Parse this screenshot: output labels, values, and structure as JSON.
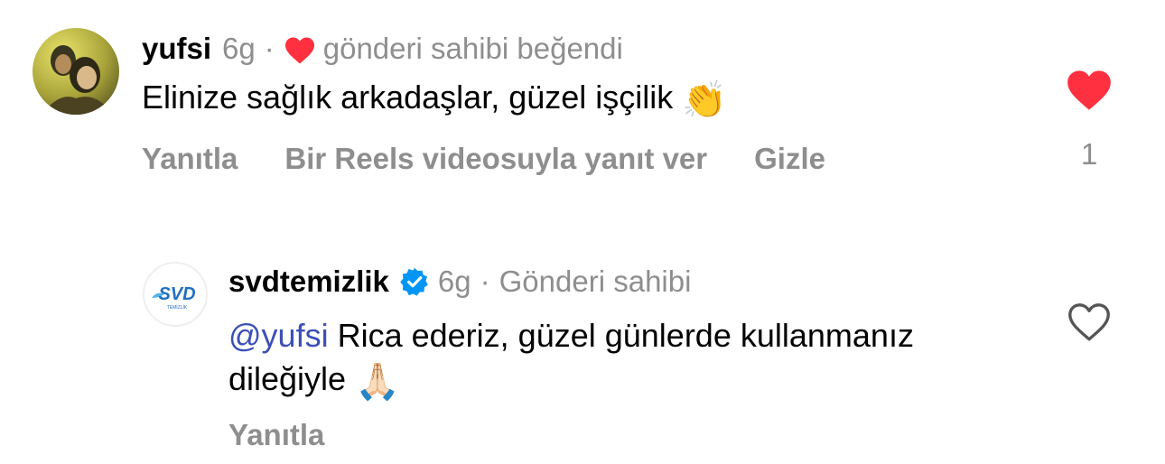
{
  "comments": [
    {
      "username": "yufsi",
      "time": "6g",
      "separator": "·",
      "liked_by_author_label": "gönderi sahibi beğendi",
      "text": "Elinize sağlık arkadaşlar, güzel işçilik",
      "text_emoji": "👏",
      "actions": {
        "reply": "Yanıtla",
        "reels_reply": "Bir Reels videosuyla yanıt ver",
        "hide": "Gizle"
      },
      "like_count": "1",
      "liked": true
    },
    {
      "username": "svdtemizlik",
      "verified": true,
      "time": "6g",
      "separator": "·",
      "author_label": "Gönderi sahibi",
      "mention": "@yufsi",
      "text": "Rica ederiz, güzel günlerde kullanmanız dileğiyle",
      "text_emoji": "🙏🏻",
      "avatar_text": "SVD",
      "avatar_subtext": "TEMİZLİK",
      "actions": {
        "reply": "Yanıtla"
      },
      "liked": false
    }
  ],
  "colors": {
    "like_red": "#ff3040",
    "meta_gray": "#8e8e8e",
    "mention_blue": "#3c4fb8",
    "verified_blue": "#0095f6",
    "svd_blue": "#1f6fc0"
  },
  "icons": {
    "comment1_heart": "heart-filled-icon",
    "comment2_heart": "heart-outline-icon",
    "verified": "verified-badge-icon"
  }
}
